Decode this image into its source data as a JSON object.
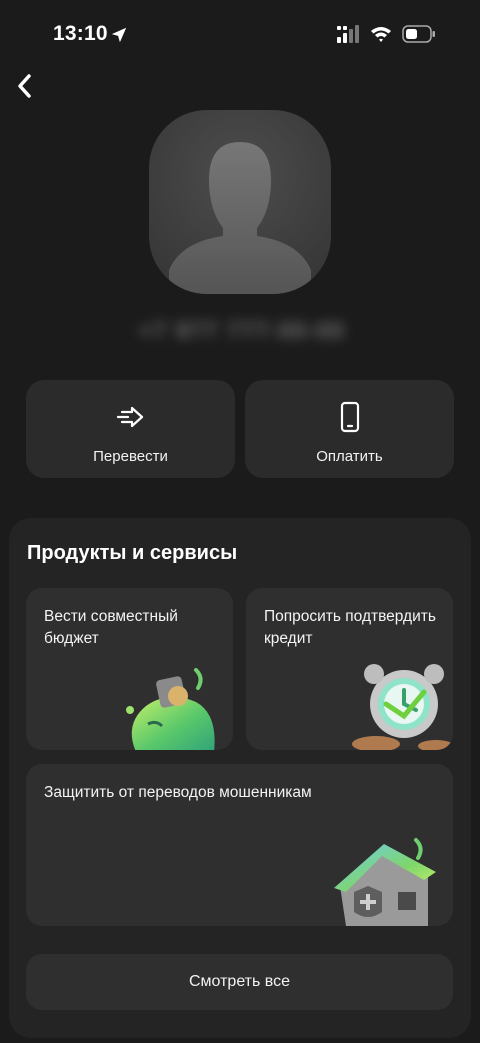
{
  "status_bar": {
    "time": "13:10",
    "icons": [
      "location-arrow-icon",
      "cellular-signal-icon",
      "wifi-icon",
      "battery-icon"
    ]
  },
  "header": {
    "back_icon": "chevron-left-icon"
  },
  "contact": {
    "avatar_icon": "person-silhouette-icon",
    "phone_masked": "+7 977 777-00-00"
  },
  "actions": [
    {
      "label": "Перевести",
      "icon": "arrow-right-icon"
    },
    {
      "label": "Оплатить",
      "icon": "smartphone-icon"
    }
  ],
  "products": {
    "title": "Продукты и сервисы",
    "cards": [
      {
        "label": "Вести совместный бюджет",
        "icon": "wallet-illustration"
      },
      {
        "label": "Попросить подтвердить кредит",
        "icon": "alarm-clock-illustration"
      },
      {
        "label": "Защитить от переводов мошенникам",
        "icon": "shield-house-illustration"
      }
    ],
    "see_all_label": "Смотреть все"
  },
  "colors": {
    "background": "#1b1b1b",
    "card": "#2b2b2b",
    "panel": "#242424",
    "accent_green": "#7ed957"
  }
}
